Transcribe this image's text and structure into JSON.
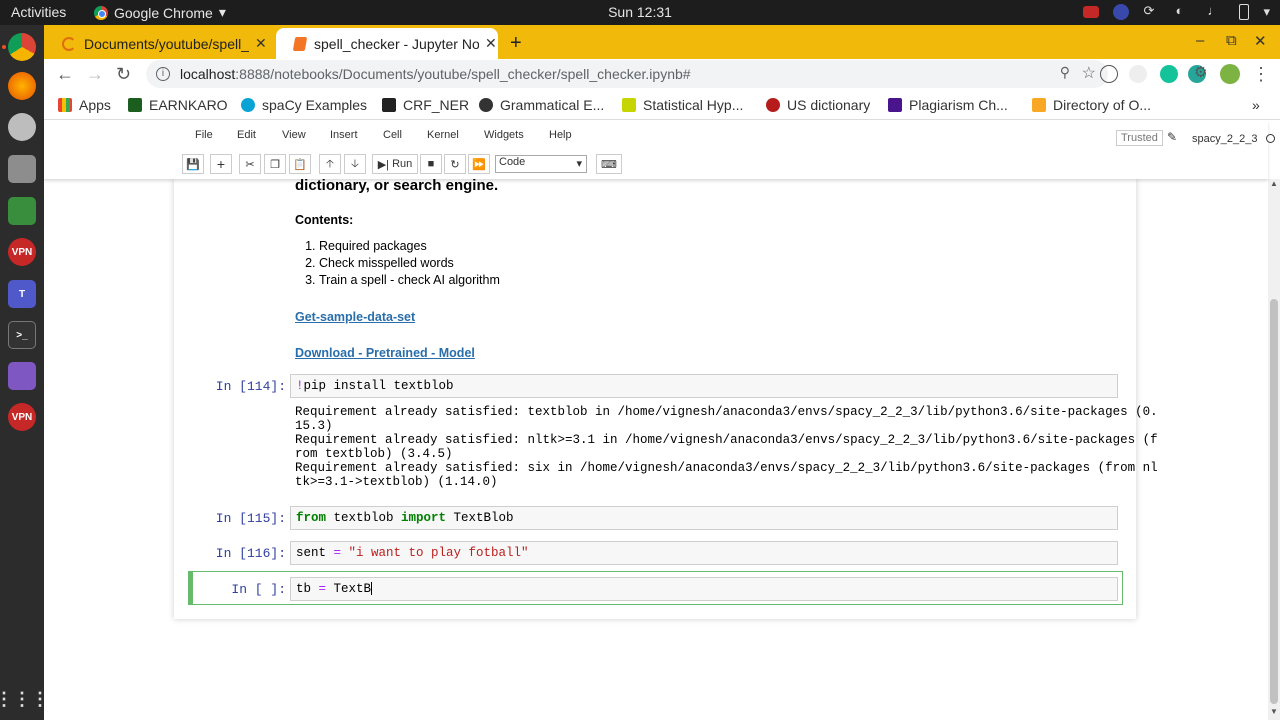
{
  "topbar": {
    "activities": "Activities",
    "app_name": "Google Chrome",
    "clock": "Sun 12:31"
  },
  "dock": {
    "items": [
      "chrome-icon",
      "firefox-icon",
      "webcam-icon",
      "files-icon",
      "terminal-icon-green",
      "ssl-vpn-icon",
      "teams-icon",
      "terminal-icon",
      "screenshot-icon",
      "ssl-vpn-icon-2"
    ],
    "apps_grid": "show-apps-icon"
  },
  "tabs": [
    {
      "label": "Documents/youtube/spell_checker/",
      "active": false
    },
    {
      "label": "spell_checker - Jupyter Notebook",
      "active": true
    }
  ],
  "omnibox": {
    "host": "localhost",
    "path": ":8888/notebooks/Documents/youtube/spell_checker/spell_checker.ipynb#"
  },
  "bookmarks": [
    {
      "label": "Apps",
      "color": "#ea4335"
    },
    {
      "label": "EARNKARO",
      "color": "#1b5e20"
    },
    {
      "label": "spaCy Examples",
      "color": "#09a3d5"
    },
    {
      "label": "CRF_NER",
      "color": "#222222"
    },
    {
      "label": "Grammatical E...",
      "color": "#333333"
    },
    {
      "label": "Statistical Hyp...",
      "color": "#c6d400"
    },
    {
      "label": "US dictionary",
      "color": "#b71c1c"
    },
    {
      "label": "Plagiarism Ch...",
      "color": "#4a148c"
    },
    {
      "label": "Directory of O...",
      "color": "#f9a825"
    }
  ],
  "jupyter": {
    "menu": [
      "File",
      "Edit",
      "View",
      "Insert",
      "Cell",
      "Kernel",
      "Widgets",
      "Help"
    ],
    "trusted": "Trusted",
    "kernel": "spacy_2_2_3",
    "run_label": "Run",
    "cell_type": "Code"
  },
  "notebook": {
    "md_heading": "dictionary, or search engine.",
    "contents_label": "Contents:",
    "contents": [
      "Required packages",
      "Check misspelled words",
      "Train a spell - check AI algorithm"
    ],
    "link1": "Get-sample-data-set",
    "link2": "Download - Pretrained - Model",
    "cells": [
      {
        "prompt": "In [114]:",
        "output": "Requirement already satisfied: textblob in /home/vignesh/anaconda3/envs/spacy_2_2_3/lib/python3.6/site-packages (0.\n15.3)\nRequirement already satisfied: nltk>=3.1 in /home/vignesh/anaconda3/envs/spacy_2_2_3/lib/python3.6/site-packages (f\nrom textblob) (3.4.5)\nRequirement already satisfied: six in /home/vignesh/anaconda3/envs/spacy_2_2_3/lib/python3.6/site-packages (from nl\ntk>=3.1->textblob) (1.14.0)"
      },
      {
        "prompt": "In [115]:"
      },
      {
        "prompt": "In [116]:"
      },
      {
        "prompt": "In [ ]:"
      }
    ],
    "code": {
      "c114_bang": "!",
      "c114_rest": "pip install textblob",
      "c115_from": "from",
      "c115_mid": " textblob ",
      "c115_import": "import",
      "c115_rest": " TextBlob",
      "c116_var": "sent ",
      "c116_eq": "=",
      "c116_str": " \"i want to play fotball\"",
      "c117_var": "tb ",
      "c117_eq": "=",
      "c117_rest": " TextB"
    }
  }
}
